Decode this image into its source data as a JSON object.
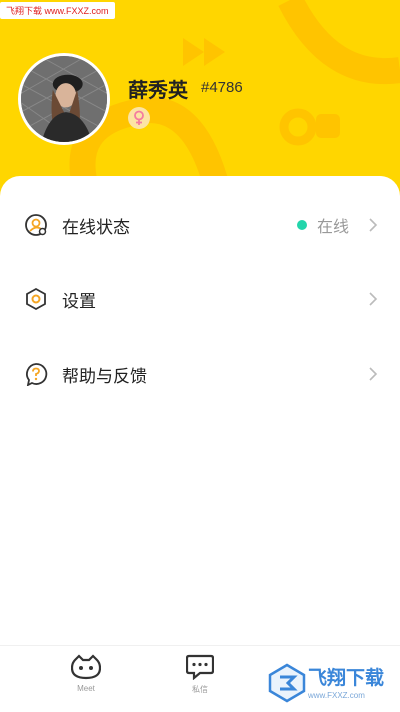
{
  "watermark_top": "飞翔下载 www.FXXZ.com",
  "profile": {
    "username": "薛秀英",
    "user_id": "#4786",
    "gender_icon": "female-icon"
  },
  "menu": [
    {
      "label": "在线状态",
      "icon": "online-status-icon",
      "status": "在线",
      "status_color": "#23D5AB"
    },
    {
      "label": "设置",
      "icon": "settings-icon"
    },
    {
      "label": "帮助与反馈",
      "icon": "help-feedback-icon"
    }
  ],
  "tabs": [
    {
      "label": "Meet",
      "icon": "meet-icon"
    },
    {
      "label": "私信",
      "icon": "message-icon"
    }
  ],
  "watermark_bottom": {
    "name": "飞翔下载",
    "url": "www.FXXZ.com"
  },
  "colors": {
    "brand": "#FFD600",
    "accent": "#F5A623"
  }
}
